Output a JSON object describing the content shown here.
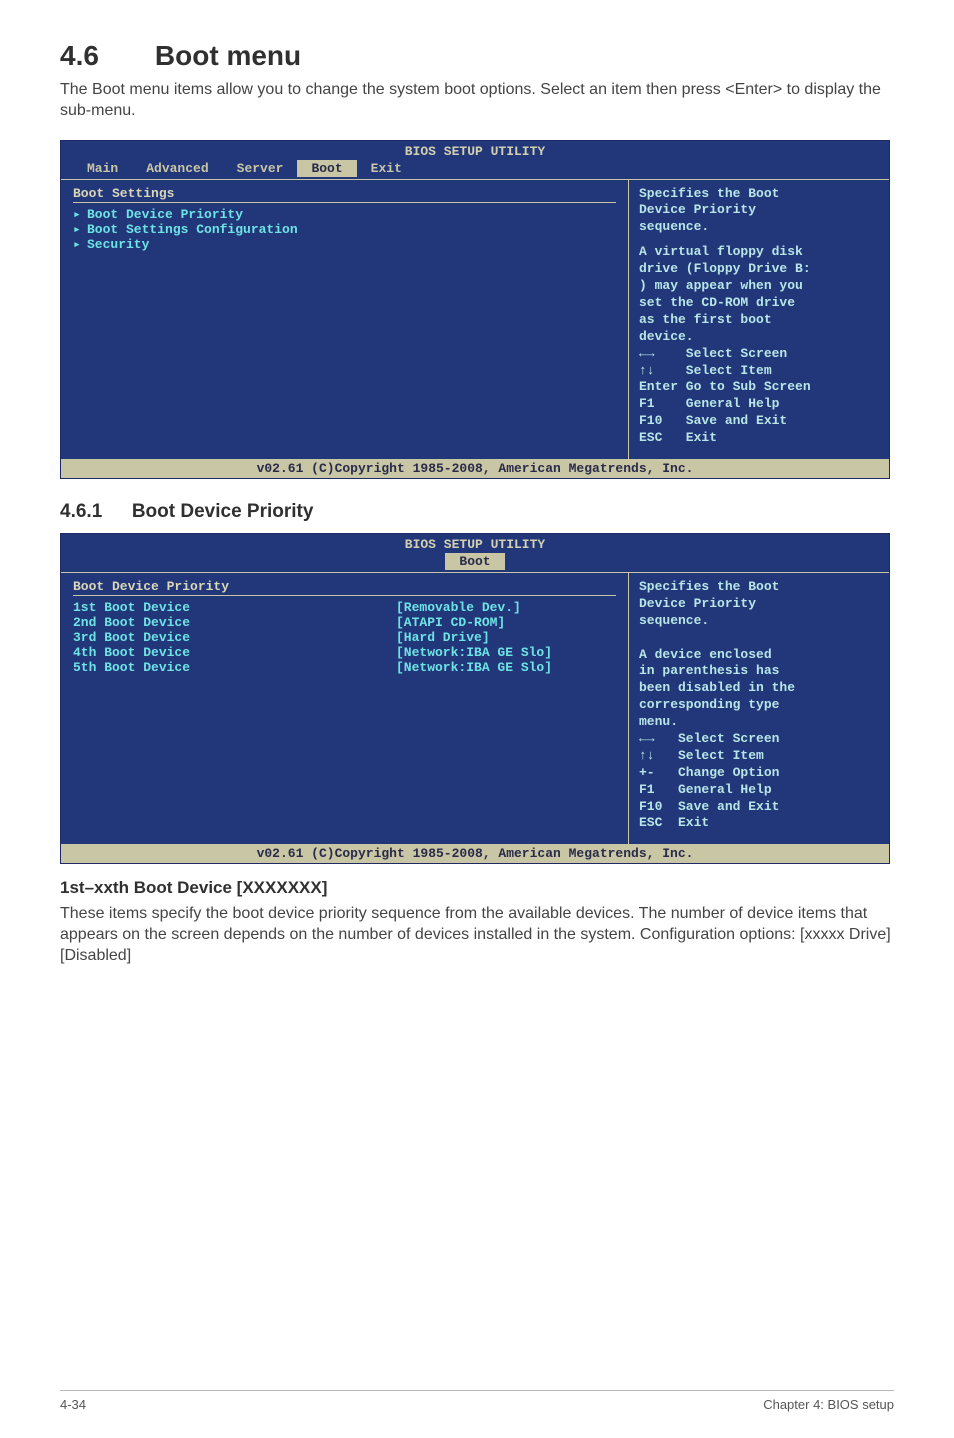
{
  "section": {
    "number_title": "4.6  Boot menu",
    "desc": "The Boot menu items allow you to change the system boot options. Select an item then press <Enter> to display the sub-menu."
  },
  "bios1": {
    "title": "BIOS SETUP UTILITY",
    "tabs": [
      "Main",
      "Advanced",
      "Server",
      "Boot",
      "Exit"
    ],
    "active_tab": 3,
    "heading": "Boot Settings",
    "items": [
      {
        "arrow": "▸",
        "label": "Boot Device Priority",
        "cls": "cyan"
      },
      {
        "arrow": "",
        "label": "",
        "cls": ""
      },
      {
        "arrow": "▸",
        "label": "Boot Settings Configuration",
        "cls": "cyan"
      },
      {
        "arrow": "▸",
        "label": "Security",
        "cls": "cyan"
      }
    ],
    "help_title": "Specifies the Boot\nDevice Priority\nsequence.",
    "help_body": "A virtual floppy disk\ndrive (Floppy Drive B:\n) may appear when you\nset the CD-ROM drive\nas the first boot\ndevice.",
    "keys": "←→    Select Screen\n↑↓    Select Item\nEnter Go to Sub Screen\nF1    General Help\nF10   Save and Exit\nESC   Exit",
    "footer": "v02.61 (C)Copyright 1985-2008, American Megatrends, Inc."
  },
  "sub": {
    "number": "4.6.1",
    "title": "Boot Device Priority"
  },
  "bios2": {
    "title": "BIOS SETUP UTILITY",
    "tab": "Boot",
    "heading": "Boot Device Priority",
    "rows": [
      {
        "label": "1st Boot Device",
        "value": "[Removable Dev.]"
      },
      {
        "label": "2nd Boot Device",
        "value": "[ATAPI CD-ROM]"
      },
      {
        "label": "3rd Boot Device",
        "value": "[Hard Drive]"
      },
      {
        "label": "4th Boot Device",
        "value": "[Network:IBA GE Slo]"
      },
      {
        "label": "5th Boot Device",
        "value": "[Network:IBA GE Slo]"
      }
    ],
    "help": "Specifies the Boot\nDevice Priority\nsequence.\n\nA device enclosed\nin parenthesis has\nbeen disabled in the\ncorresponding type\nmenu.",
    "keys": "←→   Select Screen\n↑↓   Select Item\n+-   Change Option\nF1   General Help\nF10  Save and Exit\nESC  Exit",
    "footer": "v02.61 (C)Copyright 1985-2008, American Megatrends, Inc."
  },
  "field": {
    "title": "1st–xxth Boot Device [XXXXXXX]",
    "desc": "These items specify the boot device priority sequence from the available devices. The number of device items that appears on the screen depends on the number of devices installed in the system. Configuration options: [xxxxx Drive] [Disabled]"
  },
  "pagefooter": {
    "left": "4-34",
    "right": "Chapter 4: BIOS setup"
  }
}
